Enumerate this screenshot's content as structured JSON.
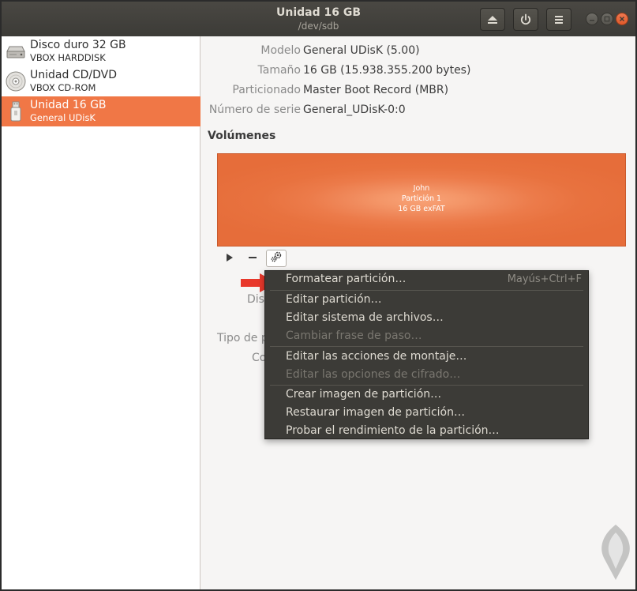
{
  "header": {
    "title": "Unidad 16 GB",
    "subtitle": "/dev/sdb",
    "buttons": [
      {
        "name": "eject-button",
        "icon": "eject-icon"
      },
      {
        "name": "power-off-button",
        "icon": "power-icon"
      },
      {
        "name": "menu-button",
        "icon": "hamburger-icon"
      }
    ],
    "window_controls": [
      "minimize",
      "maximize",
      "close"
    ]
  },
  "sidebar": {
    "drives": [
      {
        "name": "Disco duro 32 GB",
        "sub": "VBOX HARDDISK",
        "icon": "hard-disk-icon",
        "selected": false
      },
      {
        "name": "Unidad CD/DVD",
        "sub": "VBOX CD-ROM",
        "icon": "optical-disc-icon",
        "selected": false
      },
      {
        "name": "Unidad 16 GB",
        "sub": "General UDisK",
        "icon": "usb-drive-icon",
        "selected": true
      }
    ]
  },
  "properties": [
    {
      "label": "Modelo",
      "value": "General UDisK (5.00)"
    },
    {
      "label": "Tamaño",
      "value": "16 GB (15.938.355.200 bytes)"
    },
    {
      "label": "Particionado",
      "value": "Master Boot Record (MBR)"
    },
    {
      "label": "Número de serie",
      "value": "General_UDisK-0:0"
    }
  ],
  "volumes": {
    "title": "Volúmenes",
    "partition": {
      "line1": "John",
      "line2": "Partición 1",
      "line3": "16 GB exFAT"
    }
  },
  "hidden_labels": {
    "dis": "Dis",
    "tipo": "Tipo de p",
    "co": "Co"
  },
  "context_menu": {
    "items": [
      {
        "label": "Formatear partición…",
        "shortcut": "Mayús+Ctrl+F",
        "disabled": false
      },
      {
        "label": "Editar partición…",
        "shortcut": "",
        "disabled": false
      },
      {
        "label": "Editar sistema de archivos…",
        "shortcut": "",
        "disabled": false
      },
      {
        "label": "Cambiar frase de paso…",
        "shortcut": "",
        "disabled": true
      },
      {
        "label": "Editar las acciones de montaje…",
        "shortcut": "",
        "disabled": false
      },
      {
        "label": "Editar las opciones de cifrado…",
        "shortcut": "",
        "disabled": true
      },
      {
        "label": "Crear imagen de partición…",
        "shortcut": "",
        "disabled": false
      },
      {
        "label": "Restaurar imagen de partición…",
        "shortcut": "",
        "disabled": false
      },
      {
        "label": "Probar el rendimiento de la partición…",
        "shortcut": "",
        "disabled": false
      }
    ]
  },
  "colors": {
    "accent": "#f07746",
    "headerbar": "#3c3b37",
    "menu_bg": "#3c3b37",
    "annotation_arrow": "#e8382b"
  }
}
